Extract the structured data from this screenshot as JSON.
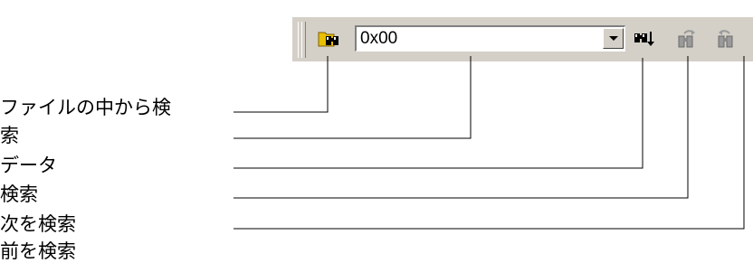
{
  "toolbar": {
    "search_value": "0x00",
    "icons": {
      "find_in_file": "folder-binoculars-icon",
      "dropdown": "chevron-down-icon",
      "find_data": "binoculars-arrow-icon",
      "find_next": "binoculars-next-icon",
      "find_previous": "binoculars-previous-icon"
    }
  },
  "annotations": {
    "label1_line1": "ファイルの中から検",
    "label1_line2": "索",
    "label2_line1": "データ",
    "label2_line2": "検索",
    "label3": "次を検索",
    "label4": "前を検索"
  },
  "colors": {
    "toolbar_bg": "#d4d0c8",
    "folder_yellow": "#e8c000"
  }
}
